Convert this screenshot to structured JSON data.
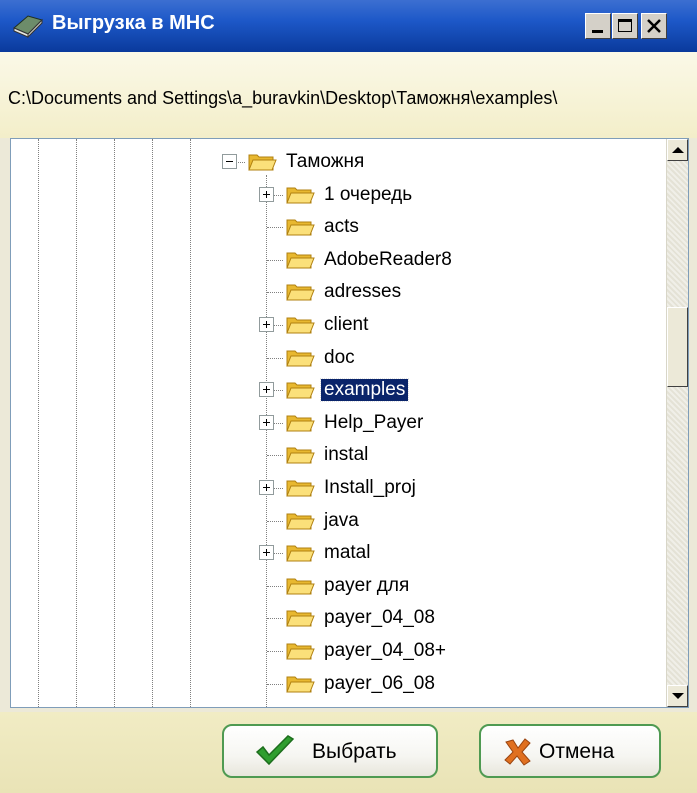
{
  "window": {
    "title": "Выгрузка в МНС",
    "controls": {
      "minimize": "minimize-icon",
      "maximize": "maximize-icon",
      "close": "close-icon"
    }
  },
  "path": {
    "text": "C:\\Documents and Settings\\a_buravkin\\Desktop\\Таможня\\examples\\"
  },
  "tree": {
    "root": {
      "label": "Таможня",
      "expanded": true
    },
    "items": [
      {
        "label": "1 очередь",
        "has_children": true,
        "selected": false
      },
      {
        "label": "acts",
        "has_children": false,
        "selected": false
      },
      {
        "label": "AdobeReader8",
        "has_children": false,
        "selected": false
      },
      {
        "label": "adresses",
        "has_children": false,
        "selected": false
      },
      {
        "label": "client",
        "has_children": true,
        "selected": false
      },
      {
        "label": "doc",
        "has_children": false,
        "selected": false
      },
      {
        "label": "examples",
        "has_children": true,
        "selected": true
      },
      {
        "label": "Help_Payer",
        "has_children": true,
        "selected": false
      },
      {
        "label": "instal",
        "has_children": false,
        "selected": false
      },
      {
        "label": "Install_proj",
        "has_children": true,
        "selected": false
      },
      {
        "label": "java",
        "has_children": false,
        "selected": false
      },
      {
        "label": "matal",
        "has_children": true,
        "selected": false
      },
      {
        "label": "payer для",
        "has_children": false,
        "selected": false
      },
      {
        "label": "payer_04_08",
        "has_children": false,
        "selected": false
      },
      {
        "label": "payer_04_08+",
        "has_children": false,
        "selected": false
      },
      {
        "label": "payer_06_08",
        "has_children": false,
        "selected": false
      }
    ]
  },
  "buttons": {
    "select": {
      "label": "Выбрать",
      "icon": "checkmark-icon"
    },
    "cancel": {
      "label": "Отмена",
      "icon": "cross-icon"
    }
  },
  "colors": {
    "titlebar": "#1d58c8",
    "selection": "#0a246a",
    "button_border": "#4f9a52",
    "checkmark": "#2f9e2f",
    "cross": "#e07020"
  }
}
